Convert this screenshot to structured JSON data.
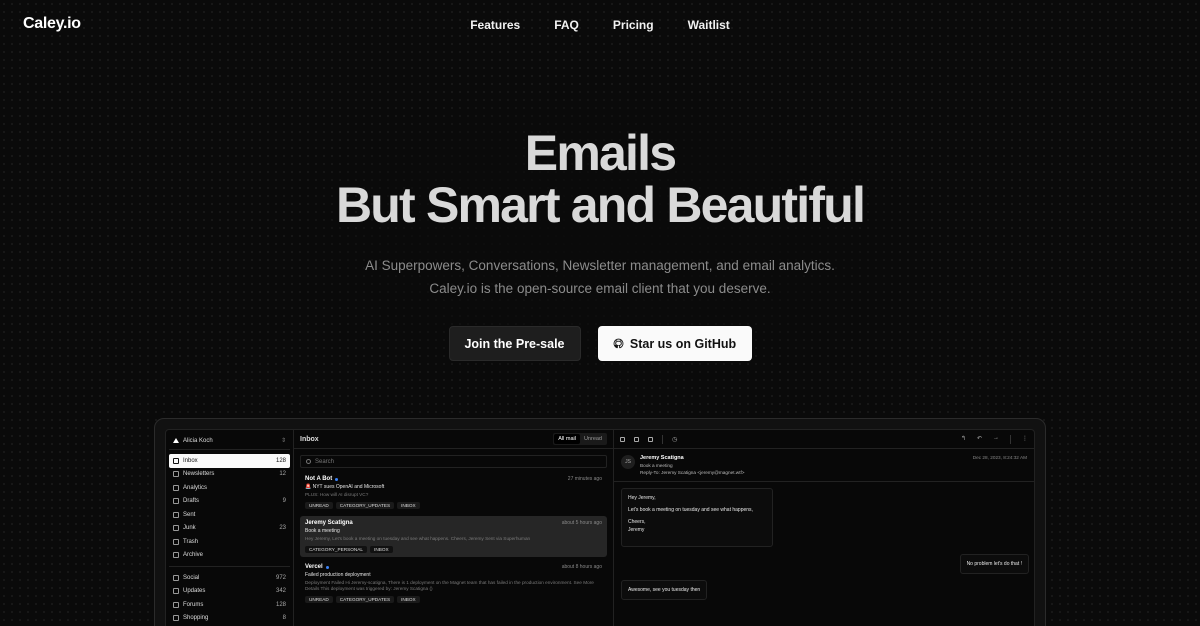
{
  "brand": {
    "logo": "Caley.io"
  },
  "nav": {
    "features": "Features",
    "faq": "FAQ",
    "pricing": "Pricing",
    "waitlist": "Waitlist"
  },
  "hero": {
    "title_line1": "Emails",
    "title_line2": "But Smart and Beautiful",
    "sub_line1": "AI Superpowers, Conversations, Newsletter management, and email analytics.",
    "sub_line2": "Caley.io is the open-source email client that you deserve.",
    "cta_primary": "Join the Pre-sale",
    "cta_secondary": "Star us on GitHub"
  },
  "app": {
    "account": "Alicia Koch",
    "sidebar_primary": [
      {
        "label": "Inbox",
        "count": "128",
        "icon": "inbox-icon",
        "active": true
      },
      {
        "label": "Newsletters",
        "count": "12",
        "icon": "newsletter-icon"
      },
      {
        "label": "Analytics",
        "count": "",
        "icon": "analytics-icon"
      },
      {
        "label": "Drafts",
        "count": "9",
        "icon": "drafts-icon"
      },
      {
        "label": "Sent",
        "count": "",
        "icon": "send-icon"
      },
      {
        "label": "Junk",
        "count": "23",
        "icon": "junk-icon"
      },
      {
        "label": "Trash",
        "count": "",
        "icon": "trash-icon"
      },
      {
        "label": "Archive",
        "count": "",
        "icon": "archive-icon"
      }
    ],
    "sidebar_secondary": [
      {
        "label": "Social",
        "count": "972",
        "icon": "social-icon"
      },
      {
        "label": "Updates",
        "count": "342",
        "icon": "updates-icon"
      },
      {
        "label": "Forums",
        "count": "128",
        "icon": "forums-icon"
      },
      {
        "label": "Shopping",
        "count": "8",
        "icon": "shopping-icon"
      }
    ],
    "list": {
      "title": "Inbox",
      "filter_all": "All mail",
      "filter_unread": "Unread",
      "search_placeholder": "Search",
      "emails": [
        {
          "from": "Not A Bot",
          "unread": true,
          "time": "27 minutes ago",
          "subject": "🚨 NYT sues OpenAI and Microsoft",
          "preview": "PLUS: How will AI disrupt VC?",
          "tags": [
            "UNREAD",
            "CATEGORY_UPDATES",
            "INBOX"
          ]
        },
        {
          "from": "Jeremy Scatigna",
          "unread": false,
          "selected": true,
          "time": "about 5 hours ago",
          "subject": "Book a meeting",
          "preview": "Hey Jeremy, Let's book a meeting on tuesday and see what happens. Cheers, Jeremy Sent via Superhuman",
          "tags": [
            "CATEGORY_PERSONAL",
            "INBOX"
          ]
        },
        {
          "from": "Vercel",
          "unread": true,
          "time": "about 8 hours ago",
          "subject": "Failed production deployment",
          "preview": "Deployment Failed Hi Jeremy-scatigna, There is 1 deployment on the Magnet team that has failed in the production environment. See More Details This deployment was triggered by: Jeremy Scatigna ()",
          "tags": [
            "UNREAD",
            "CATEGORY_UPDATES",
            "INBOX"
          ]
        }
      ]
    },
    "reader": {
      "initials": "JS",
      "name": "Jeremy Scatigna",
      "subject": "Book a meeting",
      "reply_to": "Reply-To: Jeremy Scatigna <jeremy@magnet.wtf>",
      "date": "Dec 28, 2023, 8:24:32 AM",
      "msg1_lines": [
        "Hey Jeremy,",
        "Let's book a meeting on tuesday and see what happens,",
        "Cheers,",
        "Jeremy"
      ],
      "reply1": "No problem let's do that !",
      "msg2": "Awesome, see you tuesday then"
    }
  }
}
